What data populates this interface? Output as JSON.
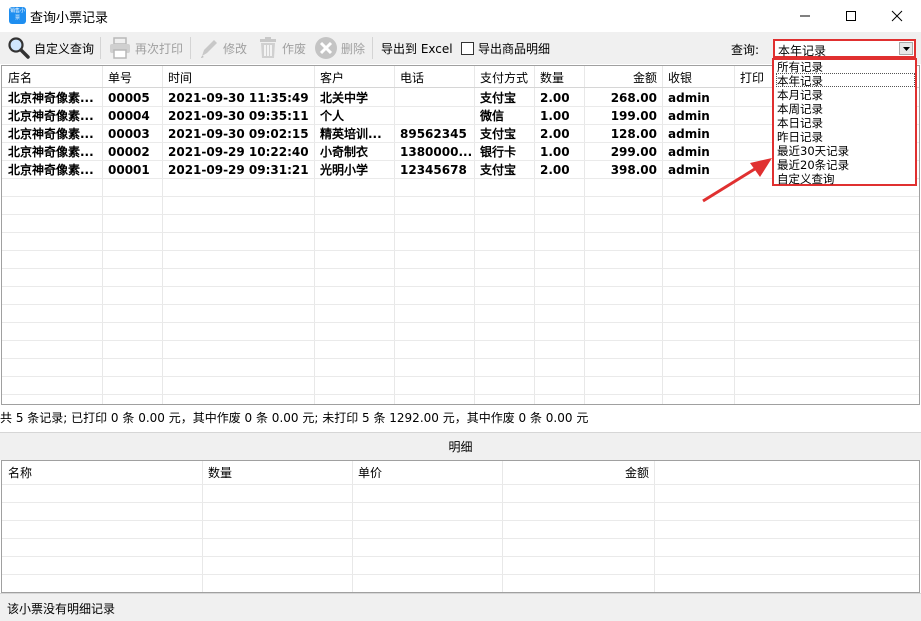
{
  "window": {
    "title": "查询小票记录",
    "icon_text": "销售小票"
  },
  "toolbar": {
    "custom_query": "自定义查询",
    "reprint": "再次打印",
    "edit": "修改",
    "void": "作废",
    "delete": "删除",
    "export_excel": "导出到 Excel",
    "export_details": "导出商品明细",
    "query_label": "查询:",
    "query_value": "本年记录"
  },
  "query_options": [
    "所有记录",
    "本年记录",
    "本月记录",
    "本周记录",
    "本日记录",
    "昨日记录",
    "最近30天记录",
    "最近20条记录",
    "自定义查询"
  ],
  "table": {
    "headers": [
      "店名",
      "单号",
      "时间",
      "客户",
      "电话",
      "支付方式",
      "数量",
      "金额",
      "收银",
      "打印"
    ],
    "rows": [
      [
        "北京神奇像素...",
        "00005",
        "2021-09-30 11:35:49",
        "北关中学",
        "",
        "支付宝",
        "2.00",
        "268.00",
        "admin",
        ""
      ],
      [
        "北京神奇像素...",
        "00004",
        "2021-09-30 09:35:11",
        "个人",
        "",
        "微信",
        "1.00",
        "199.00",
        "admin",
        ""
      ],
      [
        "北京神奇像素...",
        "00003",
        "2021-09-30 09:02:15",
        "精英培训...",
        "89562345",
        "支付宝",
        "2.00",
        "128.00",
        "admin",
        ""
      ],
      [
        "北京神奇像素...",
        "00002",
        "2021-09-29 10:22:40",
        "小奇制衣",
        "1380000...",
        "银行卡",
        "1.00",
        "299.00",
        "admin",
        ""
      ],
      [
        "北京神奇像素...",
        "00001",
        "2021-09-29 09:31:21",
        "光明小学",
        "12345678",
        "支付宝",
        "2.00",
        "398.00",
        "admin",
        ""
      ]
    ]
  },
  "summary": "共 5 条记录;  已打印 0 条 0.00 元，其中作废 0 条 0.00 元;  未打印 5 条 1292.00 元，其中作废 0 条 0.00 元",
  "detail": {
    "title": "明细",
    "headers": [
      "名称",
      "数量",
      "单价",
      "金额"
    ]
  },
  "status": "该小票没有明细记录",
  "colors": {
    "highlight": "#e03030",
    "toolbar_bg": "#f0f0f0"
  }
}
